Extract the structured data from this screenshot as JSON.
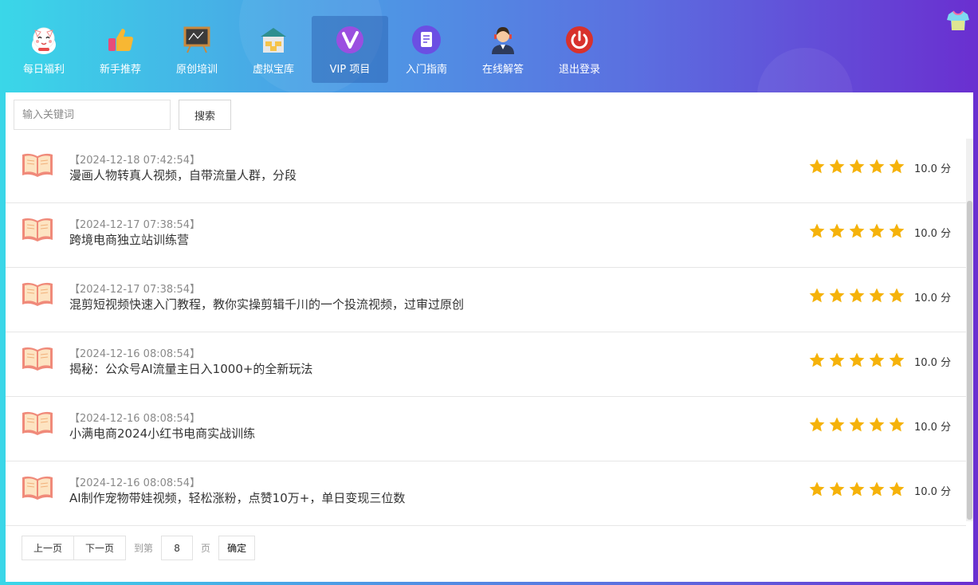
{
  "colors": {
    "star": "#f5b20a",
    "book": "#f08a7a",
    "accent": "#6a2fd0"
  },
  "nav": {
    "items": [
      {
        "label": "每日福利",
        "icon": "lucky-cat-icon"
      },
      {
        "label": "新手推荐",
        "icon": "thumbs-up-icon"
      },
      {
        "label": "原创培训",
        "icon": "chalkboard-icon"
      },
      {
        "label": "虚拟宝库",
        "icon": "treasure-house-icon"
      },
      {
        "label": "VIP 项目",
        "icon": "vip-v-icon",
        "active": true
      },
      {
        "label": "入门指南",
        "icon": "document-icon"
      },
      {
        "label": "在线解答",
        "icon": "support-agent-icon"
      },
      {
        "label": "退出登录",
        "icon": "power-icon"
      }
    ]
  },
  "search": {
    "placeholder": "输入关键词",
    "value": "",
    "button_label": "搜索"
  },
  "list": {
    "items": [
      {
        "date": "【2024-12-18 07:42:54】",
        "title": "漫画人物转真人视频，自带流量人群，分段",
        "score": "10.0 分",
        "stars": 5
      },
      {
        "date": "【2024-12-17 07:38:54】",
        "title": "跨境电商独立站训练营",
        "score": "10.0 分",
        "stars": 5
      },
      {
        "date": "【2024-12-17 07:38:54】",
        "title": "混剪短视频快速入门教程，教你实操剪辑千川的一个投流视频，过审过原创",
        "score": "10.0 分",
        "stars": 5
      },
      {
        "date": "【2024-12-16 08:08:54】",
        "title": "揭秘：公众号AI流量主日入1000+的全新玩法",
        "score": "10.0 分",
        "stars": 5
      },
      {
        "date": "【2024-12-16 08:08:54】",
        "title": "小满电商2024小红书电商实战训练",
        "score": "10.0 分",
        "stars": 5
      },
      {
        "date": "【2024-12-16 08:08:54】",
        "title": "AI制作宠物带娃视频，轻松涨粉，点赞10万+，单日变现三位数",
        "score": "10.0 分",
        "stars": 5
      }
    ]
  },
  "pager": {
    "prev_label": "上一页",
    "next_label": "下一页",
    "goto_label": "到第",
    "page_value": "8",
    "page_unit": "页",
    "confirm_label": "确定"
  }
}
